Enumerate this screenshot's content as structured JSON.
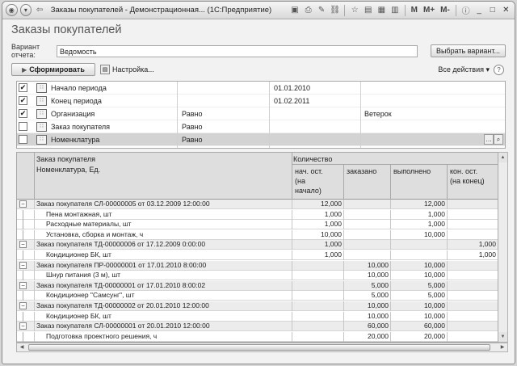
{
  "window": {
    "title": "Заказы покупателей - Демонстрационная... (1С:Предприятие)",
    "toolbar_m": "M",
    "toolbar_mplus": "M+",
    "toolbar_mminus": "M-"
  },
  "page": {
    "title": "Заказы покупателей"
  },
  "variant": {
    "label": "Вариант отчета:",
    "value": "Ведомость",
    "button": "Выбрать вариант..."
  },
  "toolbar": {
    "generate": "Сформировать",
    "settings": "Настройка...",
    "all_actions": "Все действия ▾",
    "help": "?"
  },
  "params": [
    {
      "checked": true,
      "name": "Начало периода",
      "condition": "",
      "value": "01.01.2010",
      "value2": ""
    },
    {
      "checked": true,
      "name": "Конец периода",
      "condition": "",
      "value": "01.02.2011",
      "value2": ""
    },
    {
      "checked": true,
      "name": "Организация",
      "condition": "Равно",
      "value": "",
      "value2": "Ветерок"
    },
    {
      "checked": false,
      "name": "Заказ покупателя",
      "condition": "Равно",
      "value": "",
      "value2": ""
    },
    {
      "checked": false,
      "name": "Номенклатура",
      "condition": "Равно",
      "value": "",
      "value2": ""
    }
  ],
  "report": {
    "header": {
      "col1_line1": "Заказ покупателя",
      "col1_line2": "Номенклатура, Ед.",
      "qty": "Количество",
      "start_l1": "нач. ост.",
      "start_l2": "(на",
      "start_l3": "начало)",
      "ordered": "заказано",
      "done": "выполнено",
      "end_l1": "кон. ост.",
      "end_l2": "(на конец)"
    },
    "rows": [
      {
        "group": true,
        "name": "Заказ покупателя СЛ-00000005 от 03.12.2009 12:00:00",
        "start": "12,000",
        "ordered": "",
        "done": "12,000",
        "end": ""
      },
      {
        "group": false,
        "name": "Пена монтажная, шт",
        "start": "1,000",
        "ordered": "",
        "done": "1,000",
        "end": ""
      },
      {
        "group": false,
        "name": "Расходные материалы, шт",
        "start": "1,000",
        "ordered": "",
        "done": "1,000",
        "end": ""
      },
      {
        "group": false,
        "name": "Установка, сборка и монтаж, ч",
        "start": "10,000",
        "ordered": "",
        "done": "10,000",
        "end": ""
      },
      {
        "group": true,
        "name": "Заказ покупателя ТД-00000006 от 17.12.2009 0:00:00",
        "start": "1,000",
        "ordered": "",
        "done": "",
        "end": "1,000"
      },
      {
        "group": false,
        "name": "Кондиционер БК, шт",
        "start": "1,000",
        "ordered": "",
        "done": "",
        "end": "1,000"
      },
      {
        "group": true,
        "name": "Заказ покупателя ПР-00000001 от 17.01.2010 8:00:00",
        "start": "",
        "ordered": "10,000",
        "done": "10,000",
        "end": ""
      },
      {
        "group": false,
        "name": "Шнур питания (3 м), шт",
        "start": "",
        "ordered": "10,000",
        "done": "10,000",
        "end": ""
      },
      {
        "group": true,
        "name": "Заказ покупателя ТД-00000001 от 17.01.2010 8:00:02",
        "start": "",
        "ordered": "5,000",
        "done": "5,000",
        "end": ""
      },
      {
        "group": false,
        "name": "Кондиционер \"Самсунг\", шт",
        "start": "",
        "ordered": "5,000",
        "done": "5,000",
        "end": ""
      },
      {
        "group": true,
        "name": "Заказ покупателя ТД-00000002 от 20.01.2010 12:00:00",
        "start": "",
        "ordered": "10,000",
        "done": "10,000",
        "end": ""
      },
      {
        "group": false,
        "name": "Кондиционер БК, шт",
        "start": "",
        "ordered": "10,000",
        "done": "10,000",
        "end": ""
      },
      {
        "group": true,
        "name": "Заказ покупателя СЛ-00000001 от 20.01.2010 12:00:00",
        "start": "",
        "ordered": "60,000",
        "done": "60,000",
        "end": ""
      },
      {
        "group": false,
        "name": "Подготовка проектного решения, ч",
        "start": "",
        "ordered": "20,000",
        "done": "20,000",
        "end": ""
      }
    ]
  }
}
